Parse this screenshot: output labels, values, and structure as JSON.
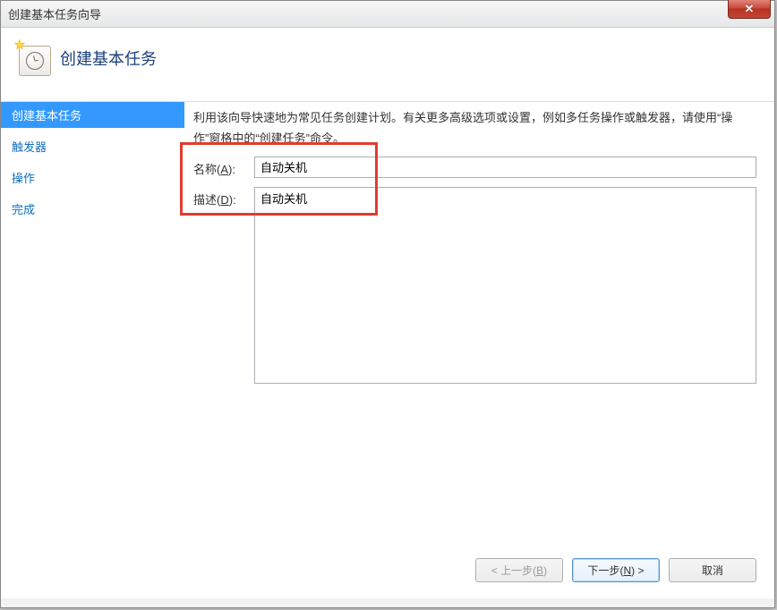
{
  "window": {
    "title": "创建基本任务向导",
    "close_glyph": "✕"
  },
  "header": {
    "title": "创建基本任务"
  },
  "sidebar": {
    "items": [
      {
        "label": "创建基本任务",
        "active": true
      },
      {
        "label": "触发器",
        "active": false
      },
      {
        "label": "操作",
        "active": false
      },
      {
        "label": "完成",
        "active": false
      }
    ]
  },
  "main": {
    "instruction": "利用该向导快速地为常见任务创建计划。有关更多高级选项或设置，例如多任务操作或触发器，请使用“操作”窗格中的“创建任务”命令。",
    "name_label_prefix": "名称(",
    "name_hotkey": "A",
    "name_label_suffix": "):",
    "name_value": "自动关机",
    "desc_label_prefix": "描述(",
    "desc_hotkey": "D",
    "desc_label_suffix": "):",
    "desc_value": "自动关机"
  },
  "buttons": {
    "back_prefix": "< 上一步(",
    "back_hotkey": "B",
    "back_suffix": ")",
    "next_prefix": "下一步(",
    "next_hotkey": "N",
    "next_suffix": ") >",
    "cancel": "取消"
  }
}
